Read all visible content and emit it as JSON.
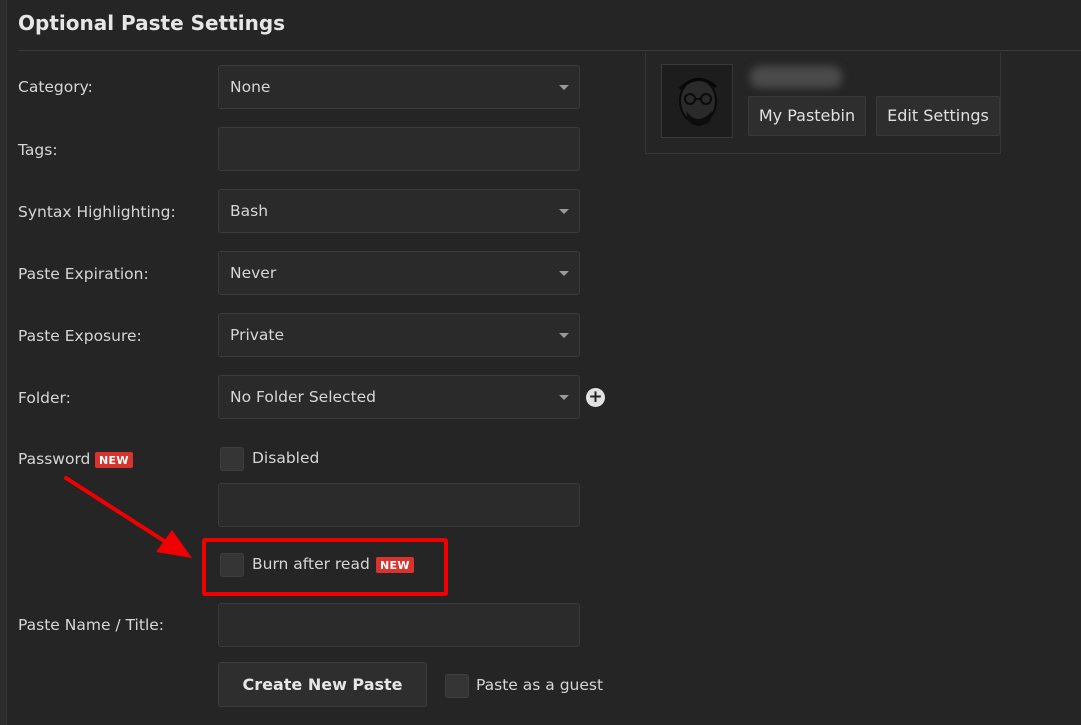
{
  "header": {
    "title": "Optional Paste Settings"
  },
  "fields": {
    "category": {
      "label": "Category:",
      "value": "None"
    },
    "tags": {
      "label": "Tags:",
      "value": ""
    },
    "syntax": {
      "label": "Syntax Highlighting:",
      "value": "Bash"
    },
    "expiration": {
      "label": "Paste Expiration:",
      "value": "Never"
    },
    "exposure": {
      "label": "Paste Exposure:",
      "value": "Private"
    },
    "folder": {
      "label": "Folder:",
      "value": "No Folder Selected"
    },
    "password": {
      "label": "Password",
      "badge": "NEW",
      "checkbox_label": "Disabled",
      "value": ""
    },
    "burn": {
      "checkbox_label": "Burn after read",
      "badge": "NEW"
    },
    "title": {
      "label": "Paste Name / Title:",
      "value": ""
    }
  },
  "actions": {
    "create_label": "Create New Paste",
    "guest_label": "Paste as a guest"
  },
  "profile": {
    "my_pastebin_label": "My Pastebin",
    "edit_settings_label": "Edit Settings"
  },
  "icons": {
    "folder_add": "plus-circle-icon",
    "dropdown": "caret-down-icon"
  },
  "colors": {
    "background": "#252525",
    "badge": "#d9332e",
    "highlight": "#f00000"
  }
}
